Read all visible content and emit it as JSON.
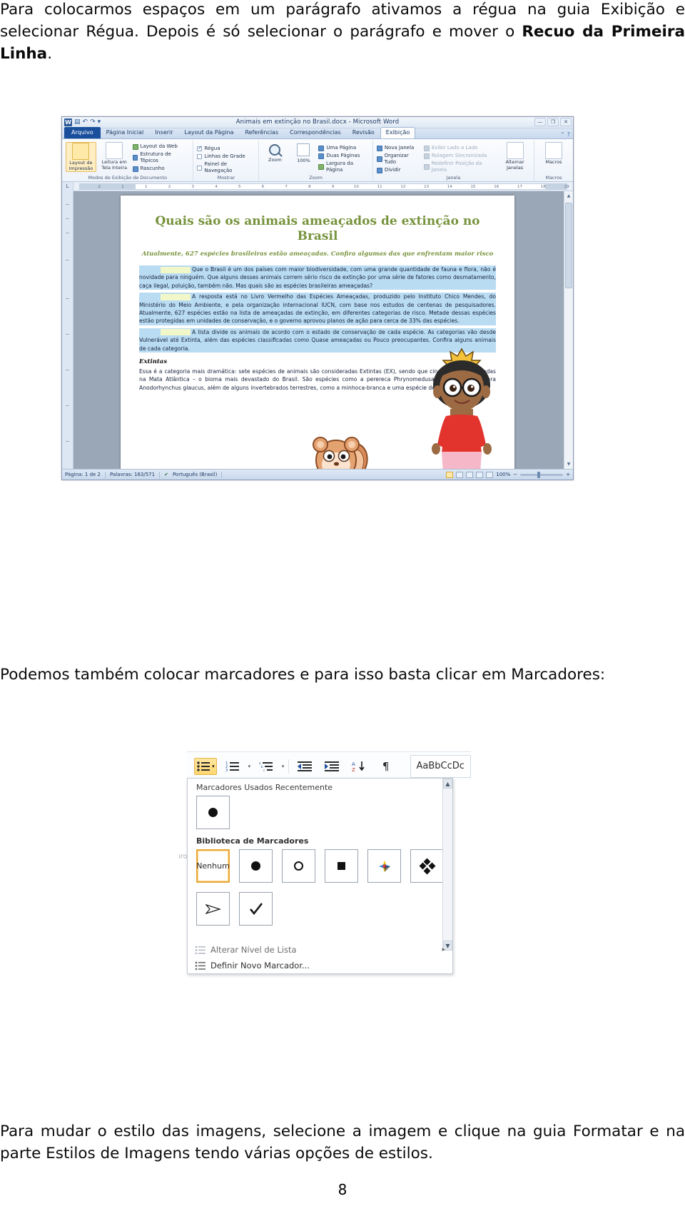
{
  "page": {
    "number": "8",
    "intro_paragraph_parts": [
      {
        "text": "Para colocarmos espaços em um parágrafo ativamos a régua na guia Exibição e selecionar Régua. Depois é só selecionar o parágrafo e mover o ",
        "bold": false
      },
      {
        "text": "Recuo da Primeira Linha",
        "bold": true
      },
      {
        "text": ".",
        "bold": false
      }
    ],
    "mid_paragraph": "Podemos também colocar marcadores e para isso basta clicar em Marcadores:",
    "outro_paragraph": "Para mudar o estilo das imagens, selecione a imagem e clique na guia Formatar e na parte Estilos de Imagens tendo várias opções de estilos."
  },
  "word_window": {
    "title": "Animais em extinção no Brasil.docx  -  Microsoft Word",
    "logo_letter": "W",
    "quick_access": [
      "save-icon",
      "undo-icon",
      "redo-icon",
      "customize-qat-icon"
    ],
    "window_buttons": [
      "minimize",
      "restore",
      "close"
    ],
    "tabs": [
      {
        "label": "Arquivo",
        "state": "file"
      },
      {
        "label": "Página Inicial",
        "state": "normal"
      },
      {
        "label": "Inserir",
        "state": "normal"
      },
      {
        "label": "Layout da Página",
        "state": "normal"
      },
      {
        "label": "Referências",
        "state": "normal"
      },
      {
        "label": "Correspondências",
        "state": "normal"
      },
      {
        "label": "Revisão",
        "state": "normal"
      },
      {
        "label": "Exibição",
        "state": "active"
      }
    ],
    "ribbon_groups": [
      {
        "label": "Modos de Exibição de Documento",
        "big_buttons": [
          {
            "label": "Layout de Impressão",
            "selected": true
          },
          {
            "label": "Leitura em Tela Inteira",
            "selected": false
          }
        ],
        "items": [
          {
            "label": "Layout da Web",
            "kind": "icon",
            "enabled": true
          },
          {
            "label": "Estrutura de Tópicos",
            "kind": "icon",
            "enabled": true
          },
          {
            "label": "Rascunho",
            "kind": "icon",
            "enabled": true
          }
        ]
      },
      {
        "label": "Mostrar",
        "items": [
          {
            "label": "Régua",
            "kind": "checkbox",
            "checked": true
          },
          {
            "label": "Linhas de Grade",
            "kind": "checkbox",
            "checked": false
          },
          {
            "label": "Painel de Navegação",
            "kind": "checkbox",
            "checked": false
          }
        ]
      },
      {
        "label": "Zoom",
        "zoom_buttons": [
          {
            "label": "Zoom",
            "icon": "magnifier-icon"
          },
          {
            "label": "100%",
            "icon": "zoom-100-icon"
          }
        ],
        "items": [
          {
            "label": "Uma Página",
            "kind": "icon",
            "enabled": true
          },
          {
            "label": "Duas Páginas",
            "kind": "icon",
            "enabled": true
          },
          {
            "label": "Largura da Página",
            "kind": "icon",
            "enabled": true
          }
        ]
      },
      {
        "label": "Janela",
        "items": [
          {
            "label": "Nova Janela",
            "kind": "icon",
            "enabled": true
          },
          {
            "label": "Organizar Tudo",
            "kind": "icon",
            "enabled": true
          },
          {
            "label": "Dividir",
            "kind": "icon",
            "enabled": true
          },
          {
            "label": "Exibir Lado a Lado",
            "kind": "icon",
            "enabled": false
          },
          {
            "label": "Rolagem Sincronizada",
            "kind": "icon",
            "enabled": false
          },
          {
            "label": "Redefinir Posição da Janela",
            "kind": "icon",
            "enabled": false
          }
        ],
        "big_buttons": [
          {
            "label": "Alternar Janelas",
            "selected": false
          }
        ]
      },
      {
        "label": "Macros",
        "big_buttons": [
          {
            "label": "Macros",
            "selected": false
          }
        ]
      }
    ],
    "ruler_marks": [
      "2",
      "1",
      "1",
      "2",
      "3",
      "4",
      "5",
      "6",
      "7",
      "8",
      "9",
      "10",
      "11",
      "12",
      "13",
      "14",
      "15",
      "16",
      "17",
      "18",
      "19"
    ],
    "status_bar": {
      "page": "Página: 1 de 2",
      "words": "Palavras: 163/571",
      "proofing_icon": "spellcheck-icon",
      "language": "Português (Brasil)",
      "view_buttons": [
        "print-layout-view",
        "full-screen-view",
        "web-layout-view",
        "outline-view",
        "draft-view"
      ],
      "zoom_level": "100%",
      "zoom_out": "−",
      "zoom_in": "+"
    },
    "document": {
      "title": "Quais são os animais ameaçados de extinção no Brasil",
      "subtitle": "Atualmente, 627 espécies brasileiras estão ameaçadas. Confira algumas das que enfrentam maior risco",
      "paragraphs": [
        "Que o Brasil é um dos países com maior biodiversidade, com uma grande quantidade de fauna e flora, não é novidade para ninguém. Que alguns desses animais correm sério risco de extinção por uma série de fatores como desmatamento, caça ilegal, poluição, também não. Mas quais são as espécies brasileiras ameaçadas?",
        "A resposta está no Livro Vermelho das Espécies Ameaçadas, produzido pelo Instituto Chico Mendes, do Ministério do Meio Ambiente, e pela organização internacional IUCN, com base nos estudos de centenas de pesquisadores. Atualmente, 627 espécies estão na lista de ameaçadas de extinção, em diferentes categorias de risco. Metade dessas espécies estão protegidas em unidades de conservação, e o governo aprovou planos de ação para cerca de 33% das espécies.",
        "A lista divide os animais de acordo com o estado de conservação de cada espécie. As categorias vão desde Vulnerável até Extinta, além das espécies classificadas como Quase ameaçadas ou Pouco preocupantes. Confira alguns animais de cada categoria."
      ],
      "heading": "Extintas",
      "last_paragraph": "Essa é a categoria mais dramática: sete espécies de animais são consideradas Extintas (EX), sendo que cinco eram encontradas na Mata Atlântica – o bioma mais devastado do Brasil. São espécies como a perereca Phrynomedusa fimbriata ou a arara Anodorhynchus glaucus, além de alguns invertebrados terrestres, como a minhoca-branca e uma espécie de minhocuçu.",
      "colors": {
        "title": "#77933c",
        "highlight": "#b9dcf2",
        "selection_stub": "#f2f7c9"
      }
    }
  },
  "bullets_figure": {
    "toolbar": [
      {
        "name": "bullets-button",
        "label": "Marcadores",
        "active": true
      },
      {
        "name": "numbering-button",
        "label": "Numeração",
        "active": false
      },
      {
        "name": "multilevel-list-button",
        "label": "Lista de Vários Níveis",
        "active": false
      },
      {
        "name": "decrease-indent-button",
        "label": "Diminuir Recuo",
        "active": false
      },
      {
        "name": "increase-indent-button",
        "label": "Aumentar Recuo",
        "active": false
      },
      {
        "name": "sort-button",
        "label": "Classificar",
        "active": false
      },
      {
        "name": "show-marks-button",
        "label": "Mostrar Tudo",
        "active": false
      }
    ],
    "style_preview": "AaBbCcDc",
    "recent_section": "Marcadores Usados Recentemente",
    "recent_items": [
      {
        "name": "bullet-filled-circle",
        "glyph": "filled-circle"
      }
    ],
    "library_section": "Biblioteca de Marcadores",
    "library_items": [
      {
        "name": "bullet-none",
        "glyph": "none",
        "label": "Nenhum",
        "selected": true
      },
      {
        "name": "bullet-filled-circle",
        "glyph": "filled-circle",
        "label": "",
        "selected": false
      },
      {
        "name": "bullet-hollow-circle",
        "glyph": "hollow-circle",
        "label": "",
        "selected": false
      },
      {
        "name": "bullet-filled-square",
        "glyph": "filled-square",
        "label": "",
        "selected": false
      },
      {
        "name": "bullet-four-color-diamond",
        "glyph": "color-diamond",
        "label": "",
        "selected": false
      },
      {
        "name": "bullet-four-diamonds",
        "glyph": "four-diamonds",
        "label": "",
        "selected": false
      },
      {
        "name": "bullet-arrow",
        "glyph": "arrow",
        "label": "",
        "selected": false
      },
      {
        "name": "bullet-checkmark",
        "glyph": "checkmark",
        "label": "",
        "selected": false
      }
    ],
    "menu_items": [
      {
        "name": "change-list-level",
        "label": "Alterar Nível de Lista",
        "enabled": false,
        "has_submenu": true,
        "submenu_glyph": "▸"
      },
      {
        "name": "define-new-bullet",
        "label": "Definir Novo Marcador...",
        "enabled": true,
        "has_submenu": false,
        "submenu_glyph": ""
      }
    ],
    "scroll": {
      "up": "▲",
      "down": "▼"
    }
  }
}
